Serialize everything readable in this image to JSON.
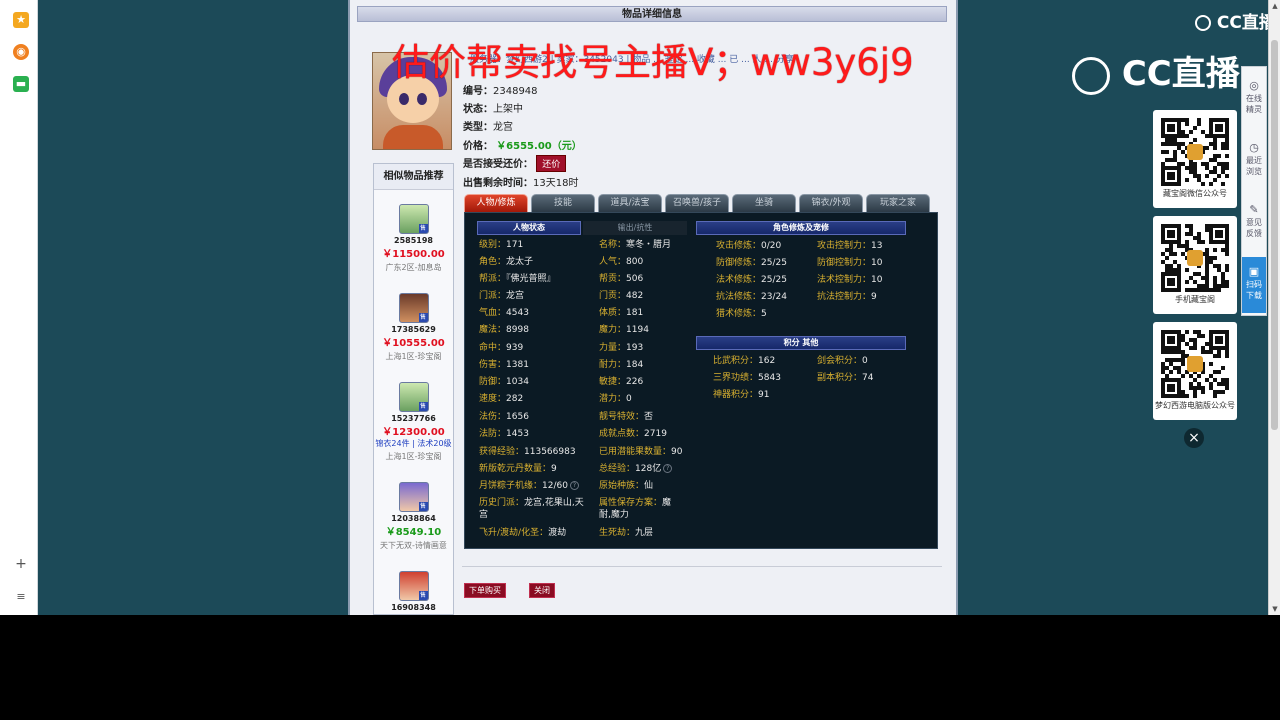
{
  "page_header": "物品详细信息",
  "watermark": "估价帮卖找号主播V；ww3y6j9",
  "nav_row": "服务器：梦幻西游2 | 卖家：3452043 | 物品 ... 鉴定 ... 收藏 ... 已 ... 人 ... 分享",
  "item": {
    "id_label": "编号：",
    "id": "2348948",
    "status_label": "状态：",
    "status": "上架中",
    "type_label": "类型：",
    "type": "龙宫",
    "price_label": "价格：",
    "price": "￥6555.00（元）",
    "bargain_label": "是否接受还价：",
    "bargain_btn": "还价",
    "remaining_label": "出售剩余时间：",
    "remaining": "13天18时"
  },
  "similar": {
    "title": "相似物品推荐",
    "items": [
      {
        "id": "2585198",
        "price": "￥11500.00",
        "server": "广东2区-加息岛",
        "extra": "",
        "green": false
      },
      {
        "id": "17385629",
        "price": "￥10555.00",
        "server": "上海1区-珍宝阁",
        "extra": "",
        "green": false
      },
      {
        "id": "15237766",
        "price": "￥12300.00",
        "server": "上海1区-珍宝阁",
        "extra": "锦衣24件 | 法术20级",
        "green": false
      },
      {
        "id": "12038864",
        "price": "￥8549.10",
        "server": "天下无双-诗情画意",
        "extra": "",
        "green": true
      },
      {
        "id": "16908348",
        "price": "",
        "server": "",
        "extra": "",
        "green": false
      }
    ]
  },
  "tabs": [
    "人物/修炼",
    "技能",
    "道具/法宝",
    "召唤兽/孩子",
    "坐骑",
    "锦衣/外观",
    "玩家之家"
  ],
  "sections": {
    "char_status": "人物状态",
    "output": "输出/抗性",
    "cultivation": "角色修炼及宠修",
    "score": "积分 其他"
  },
  "stats_left": [
    {
      "k": "级别：",
      "v": "171"
    },
    {
      "k": "角色：",
      "v": "龙太子"
    },
    {
      "k": "帮派：",
      "v": "『佛光普照』"
    },
    {
      "k": "门派：",
      "v": "龙宫"
    },
    {
      "k": "气血：",
      "v": "4543"
    },
    {
      "k": "魔法：",
      "v": "8998"
    },
    {
      "k": "命中：",
      "v": "939"
    },
    {
      "k": "伤害：",
      "v": "1381"
    },
    {
      "k": "防御：",
      "v": "1034"
    },
    {
      "k": "速度：",
      "v": "282"
    },
    {
      "k": "法伤：",
      "v": "1656"
    },
    {
      "k": "法防：",
      "v": "1453"
    },
    {
      "k": "获得经验：",
      "v": "113566983"
    },
    {
      "k": "新版乾元丹数量：",
      "v": "9"
    },
    {
      "k": "月饼粽子机缘：",
      "v": "12/60"
    },
    {
      "k": "历史门派：",
      "v": "龙宫,花果山,天"
    },
    {
      "k": "",
      "v": "宫"
    },
    {
      "k": "飞升/渡劫/化圣：",
      "v": "渡劫"
    }
  ],
  "stats_mid": [
    {
      "k": "名称：",
      "v": "寒冬・腊月"
    },
    {
      "k": "人气：",
      "v": "800"
    },
    {
      "k": "帮贡：",
      "v": "506"
    },
    {
      "k": "门贡：",
      "v": "482"
    },
    {
      "k": "体质：",
      "v": "181"
    },
    {
      "k": "魔力：",
      "v": "1194"
    },
    {
      "k": "力量：",
      "v": "193"
    },
    {
      "k": "耐力：",
      "v": "184"
    },
    {
      "k": "敏捷：",
      "v": "226"
    },
    {
      "k": "潜力：",
      "v": "0"
    },
    {
      "k": "靓号特效：",
      "v": "否"
    },
    {
      "k": "成就点数：",
      "v": "2719"
    },
    {
      "k": "已用潜能果数量：",
      "v": "90"
    },
    {
      "k": "总经验：",
      "v": "128亿"
    },
    {
      "k": "原始种族：",
      "v": "仙"
    },
    {
      "k": "属性保存方案：",
      "v": "魔"
    },
    {
      "k": "",
      "v": "耐,魔力"
    },
    {
      "k": "生死劫：",
      "v": "九层"
    }
  ],
  "cultivation": [
    {
      "k1": "攻击修炼：",
      "v1": "0/20",
      "k2": "攻击控制力：",
      "v2": "13"
    },
    {
      "k1": "防御修炼：",
      "v1": "25/25",
      "k2": "防御控制力：",
      "v2": "10"
    },
    {
      "k1": "法术修炼：",
      "v1": "25/25",
      "k2": "法术控制力：",
      "v2": "10"
    },
    {
      "k1": "抗法修炼：",
      "v1": "23/24",
      "k2": "抗法控制力：",
      "v2": "9"
    },
    {
      "k1": "猎术修炼：",
      "v1": "5",
      "k2": "",
      "v2": ""
    }
  ],
  "scores": [
    {
      "k1": "比武积分：",
      "v1": "162",
      "k2": "剑会积分：",
      "v2": "0"
    },
    {
      "k1": "三界功绩：",
      "v1": "5843",
      "k2": "副本积分：",
      "v2": "74"
    },
    {
      "k1": "神器积分：",
      "v1": "91",
      "k2": "",
      "v2": ""
    }
  ],
  "actions": {
    "buy": "下单购买",
    "close": "关闭"
  },
  "overlay": {
    "cc_small": "CC直播",
    "cc_big": "CC直播",
    "qr": [
      {
        "caption": "藏宝阁微信公众号"
      },
      {
        "caption": "手机藏宝阁"
      },
      {
        "caption": "梦幻西游电脑版公众号"
      }
    ],
    "close": "×",
    "tools": [
      {
        "icon": "◎",
        "label": "在线\n精灵"
      },
      {
        "icon": "◷",
        "label": "最近\n浏览"
      },
      {
        "icon": "✎",
        "label": "意见\n反馈"
      },
      {
        "icon": "▣",
        "label": "扫码\n下载"
      }
    ]
  },
  "colors": {
    "accent_red": "#a0102a",
    "price_green": "#1a9a1a",
    "panel_bg": "#0b1a24",
    "key_gold": "#d8b030"
  }
}
